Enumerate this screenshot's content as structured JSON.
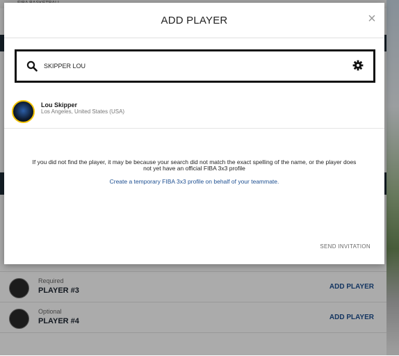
{
  "background": {
    "brand_text": "FIBA BASKETBALL",
    "players": [
      {
        "requirement": "Required",
        "name": "PLAYER #3",
        "action": "ADD PLAYER"
      },
      {
        "requirement": "Optional",
        "name": "PLAYER #4",
        "action": "ADD PLAYER"
      }
    ]
  },
  "modal": {
    "title": "ADD PLAYER",
    "close_symbol": "×",
    "close_icon": "close-icon",
    "search": {
      "value": "SKIPPER LOU",
      "icon": "search-icon",
      "settings_icon": "gear-icon"
    },
    "results": [
      {
        "name": "Lou Skipper",
        "location": "Los Angeles, United States (USA)"
      }
    ],
    "notice_text": "If you did not find the player, it may be because your search did not match the exact spelling of the name, or the player does not yet have an official FIBA 3x3 profile",
    "create_link": "Create a temporary FIBA 3x3 profile on behalf of your teammate.",
    "send_invitation": "SEND INVITATION"
  },
  "colors": {
    "accent": "#1d4f91",
    "avatar_ring": "#f2c200",
    "overlay": "rgba(0,0,0,0.33)"
  }
}
